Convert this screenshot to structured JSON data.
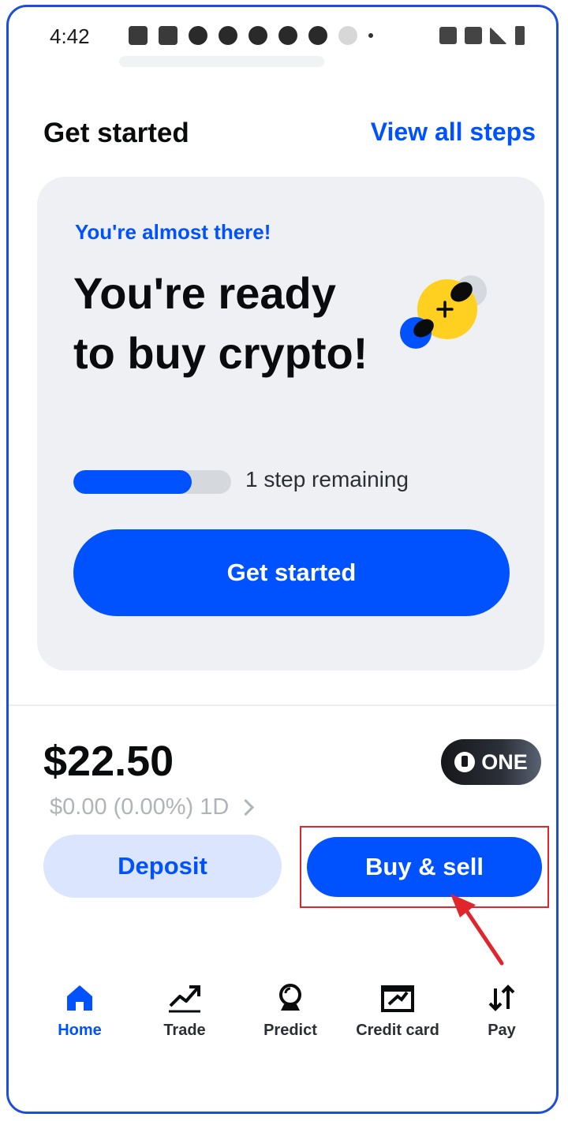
{
  "status_bar": {
    "time": "4:42"
  },
  "header": {
    "title": "Get started",
    "view_all_label": "View all steps"
  },
  "card": {
    "eyebrow": "You're almost there!",
    "heading": "You're ready to buy crypto!",
    "progress_label": "1 step remaining",
    "progress_fraction": 0.75,
    "button_label": "Get started"
  },
  "balance": {
    "amount": "$22.50",
    "change": "$0.00 (0.00%) 1D",
    "badge_label": "ONE"
  },
  "actions": {
    "deposit_label": "Deposit",
    "buy_sell_label": "Buy & sell"
  },
  "nav": {
    "items": [
      {
        "label": "Home",
        "icon": "home-icon"
      },
      {
        "label": "Trade",
        "icon": "trend-icon"
      },
      {
        "label": "Predict",
        "icon": "crystal-ball-icon"
      },
      {
        "label": "Credit card",
        "icon": "credit-card-icon"
      },
      {
        "label": "Pay",
        "icon": "transfer-arrows-icon"
      }
    ]
  },
  "colors": {
    "accent": "#0052ff",
    "highlight": "#e0262d"
  }
}
